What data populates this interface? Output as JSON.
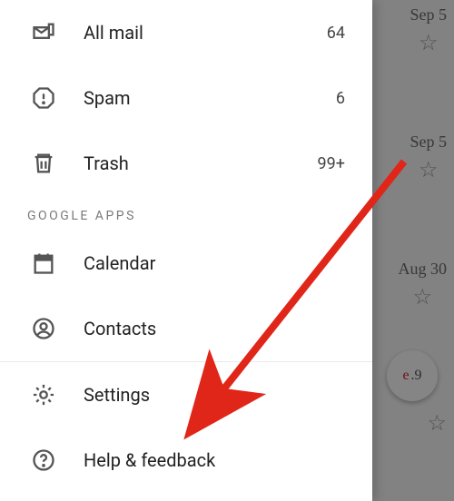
{
  "bg": {
    "rows": [
      {
        "date": "Sep 5"
      },
      {
        "date": "Sep 5"
      },
      {
        "date": "Aug 30"
      }
    ],
    "bubble": {
      "pre": "e",
      "num": ".9"
    }
  },
  "drawer": {
    "main": [
      {
        "label": "All mail",
        "count": "64",
        "icon": "all-mail-icon"
      },
      {
        "label": "Spam",
        "count": "6",
        "icon": "spam-icon"
      },
      {
        "label": "Trash",
        "count": "99+",
        "icon": "trash-icon"
      }
    ],
    "section_google_apps": "GOOGLE APPS",
    "google": [
      {
        "label": "Calendar",
        "icon": "calendar-icon"
      },
      {
        "label": "Contacts",
        "icon": "contacts-icon"
      }
    ],
    "footer": [
      {
        "label": "Settings",
        "icon": "gear-icon"
      },
      {
        "label": "Help & feedback",
        "icon": "help-icon"
      }
    ]
  },
  "annotation": {
    "arrow": "red-arrow"
  }
}
